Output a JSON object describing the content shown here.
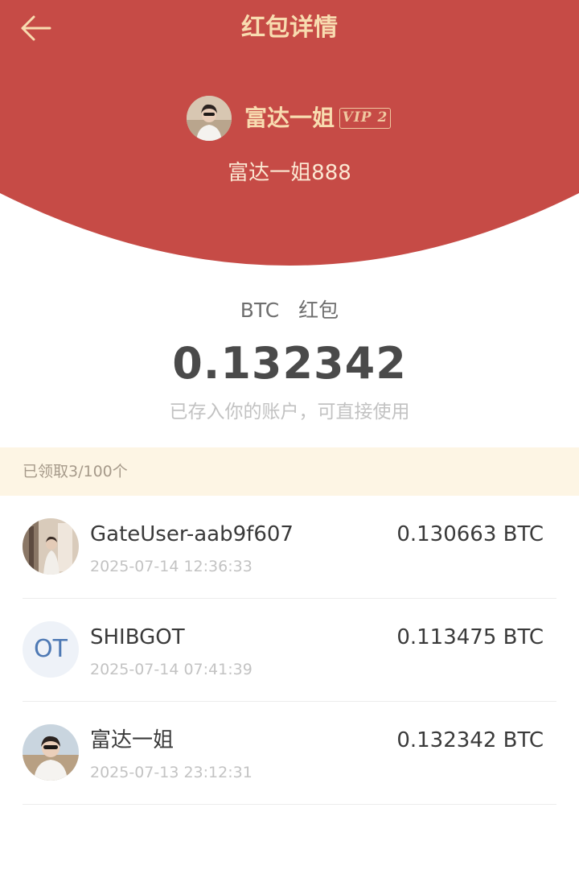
{
  "header": {
    "title": "红包详情",
    "back_icon": "arrow-left-icon",
    "background_color": "#c64b46",
    "title_color": "#f8dcb0"
  },
  "sender": {
    "name": "富达一姐",
    "vip_label": "VIP 2",
    "greeting": "富达一姐888"
  },
  "packet": {
    "currency": "BTC",
    "type_label": "红包",
    "amount": "0.132342",
    "note": "已存入你的账户，可直接使用"
  },
  "claimed": {
    "text": "已领取3/100个"
  },
  "recipients": [
    {
      "name": "GateUser-aab9f607",
      "time": "2025-07-14 12:36:33",
      "amount": "0.130663 BTC",
      "avatar": "photo"
    },
    {
      "name": "SHIBGOT",
      "time": "2025-07-14 07:41:39",
      "amount": "0.113475 BTC",
      "avatar_initials": "OT"
    },
    {
      "name": "富达一姐",
      "time": "2025-07-13 23:12:31",
      "amount": "0.132342 BTC",
      "avatar": "photo"
    }
  ]
}
